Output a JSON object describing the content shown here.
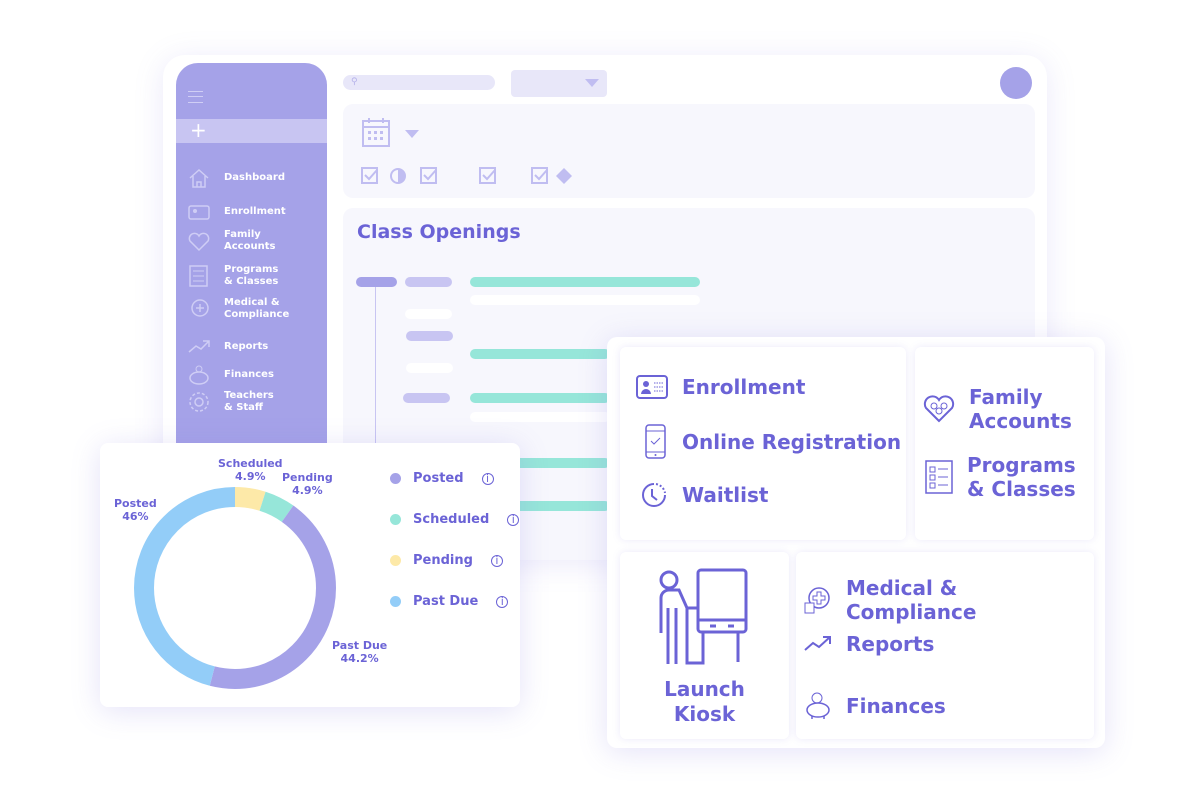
{
  "colors": {
    "accent": "#6b63d6",
    "sidebar": "#a5a2e8",
    "teal": "#96e6d9",
    "yellow": "#fde9a8",
    "blue": "#93cdf8"
  },
  "sidebar": {
    "items": [
      {
        "label": "Dashboard",
        "icon": "home-icon"
      },
      {
        "label": "Enrollment",
        "icon": "id-card-icon"
      },
      {
        "label": "Family\nAccounts",
        "icon": "heart-family-icon"
      },
      {
        "label": "Programs\n& Classes",
        "icon": "checklist-icon"
      },
      {
        "label": "Medical &\nCompliance",
        "icon": "medical-icon"
      },
      {
        "label": "Reports",
        "icon": "trend-icon"
      },
      {
        "label": "Finances",
        "icon": "piggy-bank-icon"
      },
      {
        "label": "Teachers\n& Staff",
        "icon": "gear-icon"
      }
    ]
  },
  "main": {
    "title": "Class Openings"
  },
  "features": {
    "enrollment": "Enrollment",
    "online_registration": "Online Registration",
    "waitlist": "Waitlist",
    "family_accounts": "Family\nAccounts",
    "programs_classes": "Programs\n& Classes",
    "launch_kiosk": "Launch\nKiosk",
    "medical": "Medical & Compliance",
    "reports": "Reports",
    "finances": "Finances"
  },
  "chart_data": {
    "type": "pie",
    "donut": true,
    "slices": [
      {
        "color": "#fde9a8",
        "value": 4.9
      },
      {
        "color": "#96e6d9",
        "value": 4.9
      },
      {
        "color": "#a5a2e8",
        "value": 44.2
      },
      {
        "color": "#93cdf8",
        "value": 46
      }
    ],
    "slice_labels": [
      {
        "name": "Scheduled",
        "value": "4.9%"
      },
      {
        "name": "Pending",
        "value": "4.9%"
      },
      {
        "name": "Past Due",
        "value": "44.2%"
      },
      {
        "name": "Posted",
        "value": "46%"
      }
    ],
    "legend": [
      {
        "name": "Posted",
        "color": "#a5a2e8"
      },
      {
        "name": "Scheduled",
        "color": "#96e6d9"
      },
      {
        "name": "Pending",
        "color": "#fde9a8"
      },
      {
        "name": "Past Due",
        "color": "#93cdf8"
      }
    ],
    "legend_position": "right"
  }
}
